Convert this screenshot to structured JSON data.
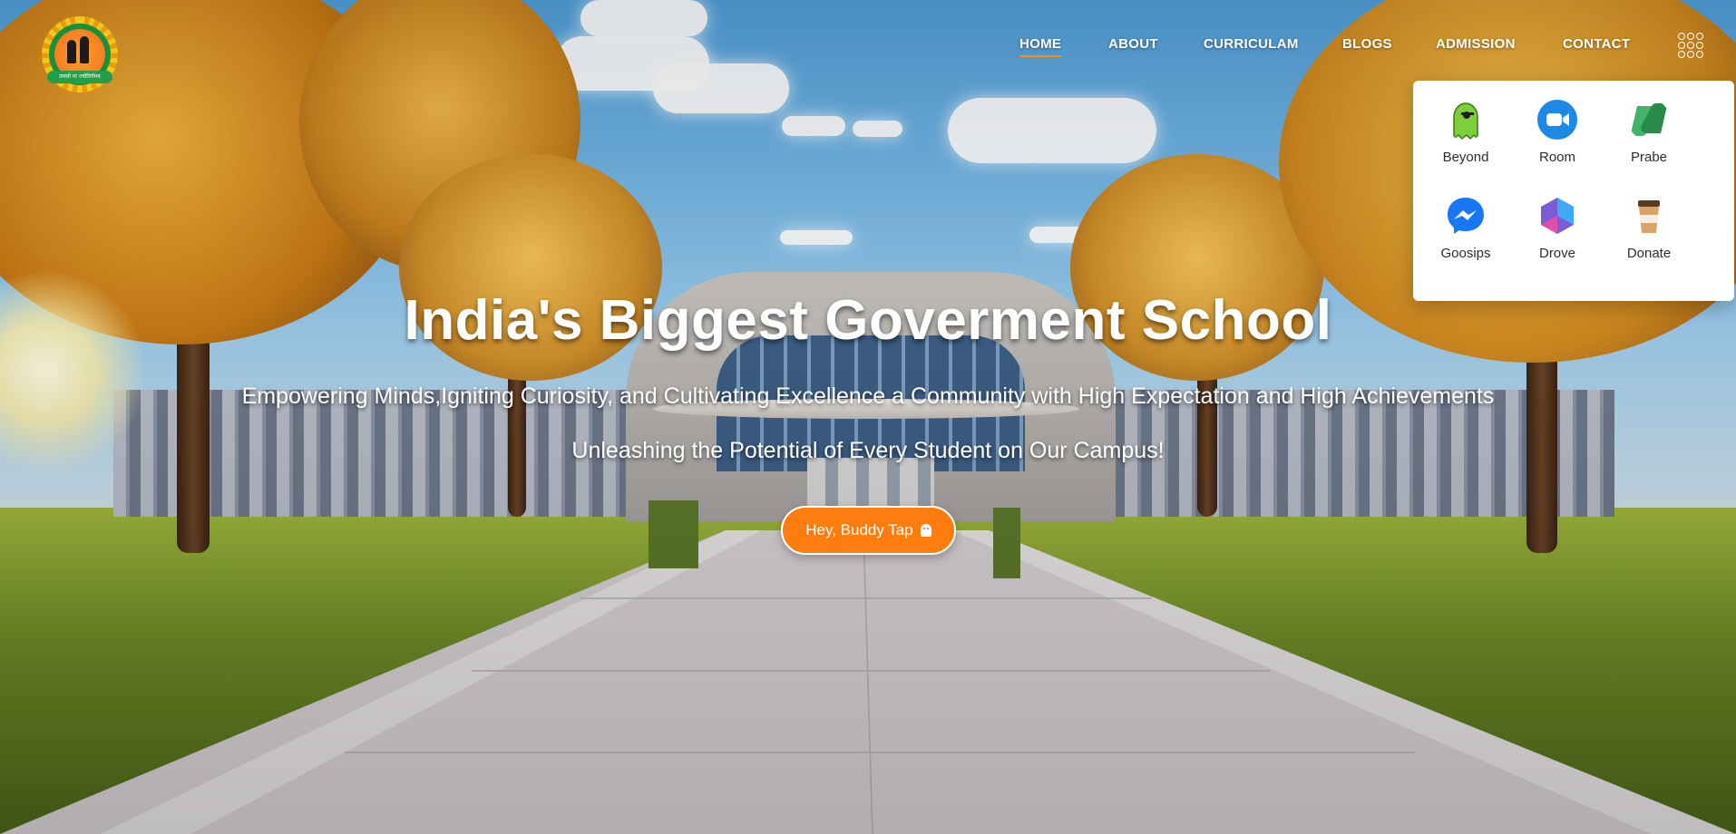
{
  "nav": {
    "items": [
      {
        "label": "HOME",
        "active": true
      },
      {
        "label": "ABOUT"
      },
      {
        "label": "CURRICULAM"
      },
      {
        "label": "BLOGS"
      },
      {
        "label": "ADMISSION"
      },
      {
        "label": "CONTACT"
      }
    ],
    "menu_icon": "grid-icon"
  },
  "logo": {
    "banner_text": "तमसो मा ज्योतिर्गमय"
  },
  "apps": [
    {
      "label": "Beyond",
      "icon": "ghost-icon",
      "color": "#7ccf3a"
    },
    {
      "label": "Room",
      "icon": "video-camera-icon",
      "color": "#1e88e5"
    },
    {
      "label": "Prabe",
      "icon": "copilot-icon",
      "color": "#2e9e4f"
    },
    {
      "label": "Goosips",
      "icon": "messenger-icon",
      "color": "#1877f2"
    },
    {
      "label": "Drove",
      "icon": "hexagon-icon",
      "color": "#7b5cd6"
    },
    {
      "label": "Donate",
      "icon": "coffee-cup-icon",
      "color": "#b06a2f"
    }
  ],
  "hero": {
    "title": "India's Biggest Goverment School",
    "subtitle": "Empowering Minds,Igniting Curiosity, and Cultivating Excellence a Community with High Expectation and High Achievements",
    "tagline": "Unleashing the Potential of Every Student on Our Campus!",
    "cta_label": "Hey, Buddy Tap",
    "cta_icon": "ghost-icon"
  },
  "colors": {
    "accent": "#ff7d0f",
    "nav_underline": "#ff8a12"
  }
}
